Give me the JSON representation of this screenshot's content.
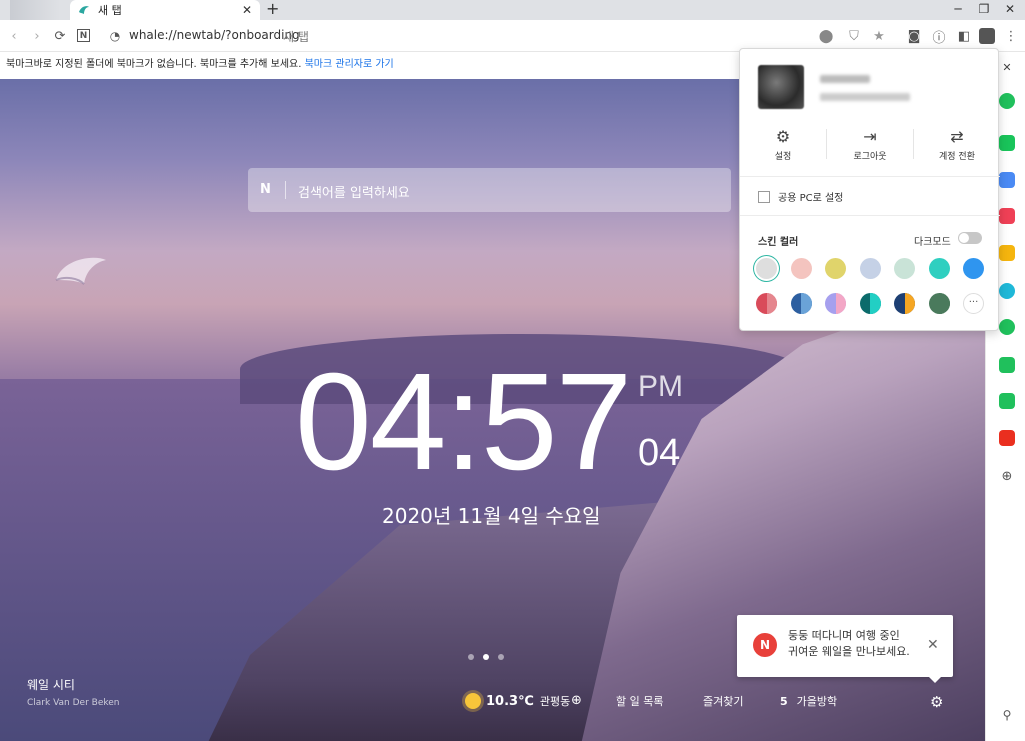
{
  "tab": {
    "title": "새 탭"
  },
  "address": {
    "url": "whale://newtab/?onboarding",
    "tab_label": "새 탭"
  },
  "bookmark_bar": {
    "message": "북마크바로 지정된 폴더에 북마크가 없습니다. 북마크를 추가해 보세요. ",
    "link": "북마크 관리자로 가기"
  },
  "search": {
    "logo": "N",
    "placeholder": "검색어를 입력하세요"
  },
  "clock": {
    "time": "04:57",
    "ampm": "PM",
    "seconds": "04",
    "date": "2020년 11월 4일 수요일"
  },
  "background": {
    "location": "웨일 시티",
    "credit": "Clark Van Der Beken"
  },
  "bottom_bar": {
    "temperature": "10.3℃",
    "weather_location": "관평동",
    "todo": "할 일 목록",
    "favorites": "즐겨찾기",
    "count": "5",
    "news": "가을방학"
  },
  "toast": {
    "badge": "N",
    "line1": "둥둥 떠다니며 여행 중인",
    "line2": "귀여운 웨일을 만나보세요."
  },
  "profile_panel": {
    "settings": "설정",
    "logout": "로그아웃",
    "switch_account": "계정 전환",
    "shared_pc": "공용 PC로 설정",
    "skin_color": "스킨 컬러",
    "dark_mode": "다크모드",
    "dark_mode_on": false,
    "colors_row1": [
      "#dedede",
      "#f4c4bf",
      "#e0d46b",
      "#c5d1e6",
      "#c9e3d7",
      "#2fcfc0",
      "#2f95ef"
    ],
    "colors_row2": [
      [
        "#d94b5a",
        "#e5868e"
      ],
      [
        "#2d5fa0",
        "#6aa3d8"
      ],
      [
        "#a6a0ee",
        "#f3a7c6"
      ],
      [
        "#0b6b6b",
        "#22cfc4"
      ],
      [
        "#1d3f73",
        "#f5a623"
      ],
      [
        "#4a7a5c",
        "#4a7a5c"
      ]
    ]
  },
  "colors": {
    "accent": "#2eb6a3",
    "link": "#1a73e8",
    "toast_badge": "#e8403a"
  }
}
